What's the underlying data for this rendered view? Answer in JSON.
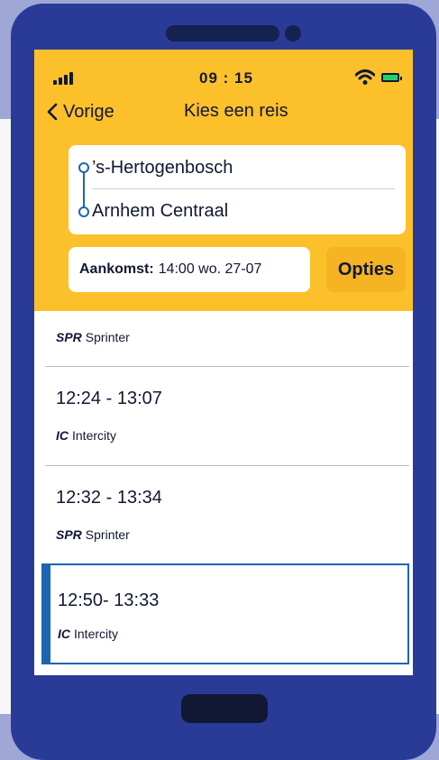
{
  "status": {
    "time": "09 : 15"
  },
  "nav": {
    "back_label": "Vorige",
    "title": "Kies een reis"
  },
  "route": {
    "from": "’s-Hertogenbosch",
    "to": "Arnhem Centraal"
  },
  "arrival": {
    "label": "Aankomst:",
    "value": "14:00 wo. 27-07"
  },
  "options_label": "Opties",
  "trips": [
    {
      "time": "",
      "type_code": "SPR",
      "type_name": "Sprinter"
    },
    {
      "time": "12:24 - 13:07",
      "type_code": "IC",
      "type_name": "Intercity"
    },
    {
      "time": "12:32 - 13:34",
      "type_code": "SPR",
      "type_name": "Sprinter"
    },
    {
      "time": "12:50- 13:33",
      "type_code": "IC",
      "type_name": "Intercity",
      "selected": true
    }
  ],
  "colors": {
    "header": "#fcc02b",
    "phone": "#2a3b97",
    "accent": "#1b66b0",
    "options": "#f6b324"
  },
  "icons": {
    "back": "chevron-left-icon",
    "signal": "signal-icon",
    "wifi": "wifi-icon",
    "battery": "battery-icon"
  }
}
